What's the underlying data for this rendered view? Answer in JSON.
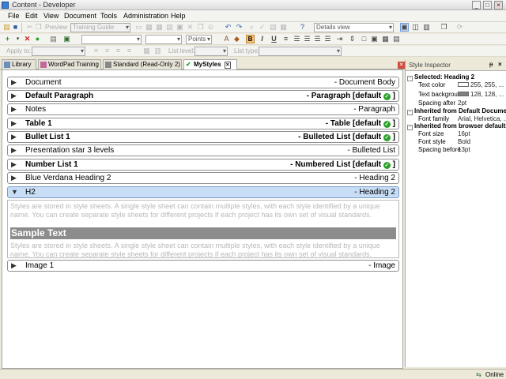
{
  "window": {
    "title": "Content - Developer"
  },
  "menu": [
    "File",
    "Edit",
    "View",
    "Document",
    "Tools",
    "Administration",
    "Help"
  ],
  "toolbar": {
    "preview_label": "Preview",
    "guide_combo": "Training Guide",
    "view_combo": "Details view",
    "points_label": "Points",
    "bold_label": "B",
    "italic_label": "I",
    "underline_label": "U",
    "apply_to_label": "Apply to:",
    "list_level_label": "List level:",
    "list_type_label": "List type:"
  },
  "tabs": [
    {
      "label": "Library",
      "active": false
    },
    {
      "label": "WordPad Training",
      "active": false
    },
    {
      "label": "Standard (Read-Only 2)",
      "active": false
    },
    {
      "label": "MyStyles",
      "active": true
    }
  ],
  "styles": [
    {
      "name": "Document",
      "kind": "- Document Body",
      "bold": false,
      "default": false,
      "expanded": false
    },
    {
      "name": "Default Paragraph",
      "kind": "- Paragraph [default",
      "bold": true,
      "default": true,
      "expanded": false
    },
    {
      "name": "Notes",
      "kind": "- Paragraph",
      "bold": false,
      "default": false,
      "expanded": false
    },
    {
      "name": "Table 1",
      "kind": "- Table [default",
      "bold": true,
      "default": true,
      "expanded": false
    },
    {
      "name": "Bullet List 1",
      "kind": "- Bulleted List [default",
      "bold": true,
      "default": true,
      "expanded": false
    },
    {
      "name": "Presentation star 3 levels",
      "kind": "- Bulleted List",
      "bold": false,
      "default": false,
      "expanded": false
    },
    {
      "name": "Number List 1",
      "kind": "- Numbered List [default",
      "bold": true,
      "default": true,
      "expanded": false
    },
    {
      "name": "Blue Verdana Heading 2",
      "kind": "- Heading 2",
      "bold": false,
      "default": false,
      "expanded": false
    },
    {
      "name": "H2",
      "kind": "- Heading 2",
      "bold": false,
      "default": false,
      "expanded": true
    }
  ],
  "after_preview_style": {
    "name": "Image 1",
    "kind": "- Image"
  },
  "preview": {
    "text_line1": "Styles are stored in style sheets. A single style sheet can contain multiple styles, with each style identified by a unique",
    "text_line2": "name. You can create separate style sheets for different projects if each project has its own set of visual standards.",
    "sample": "Sample Text"
  },
  "inspector": {
    "title": "Style Inspector",
    "selected": "Selected: Heading 2",
    "text_color_label": "Text color",
    "text_color_value": "255, 255, ...",
    "text_color_hex": "#ffffff",
    "text_bg_label": "Text backgrour",
    "text_bg_value": "128, 128, ...",
    "text_bg_hex": "#808080",
    "spacing_after_label": "Spacing after",
    "spacing_after_value": "2pt",
    "inherited_default": "Inherited from Default Documen",
    "font_family_label": "Font family",
    "font_family_value": "Arial, Helvetica, ...",
    "inherited_browser": "Inherited from browser defaults",
    "font_size_label": "Font size",
    "font_size_value": "16pt",
    "font_style_label": "Font style",
    "font_style_value": "Bold",
    "spacing_before_label": "Spacing before",
    "spacing_before_value": "13pt"
  },
  "status": {
    "online": "Online"
  },
  "colors": {
    "accent": "#c8ddf6",
    "check": "#2aa12a",
    "sample_bg": "#8c8c8c"
  },
  "icons": {
    "check": "check-circle-icon",
    "expand": "triangle-right-icon",
    "collapse": "triangle-down-icon"
  }
}
